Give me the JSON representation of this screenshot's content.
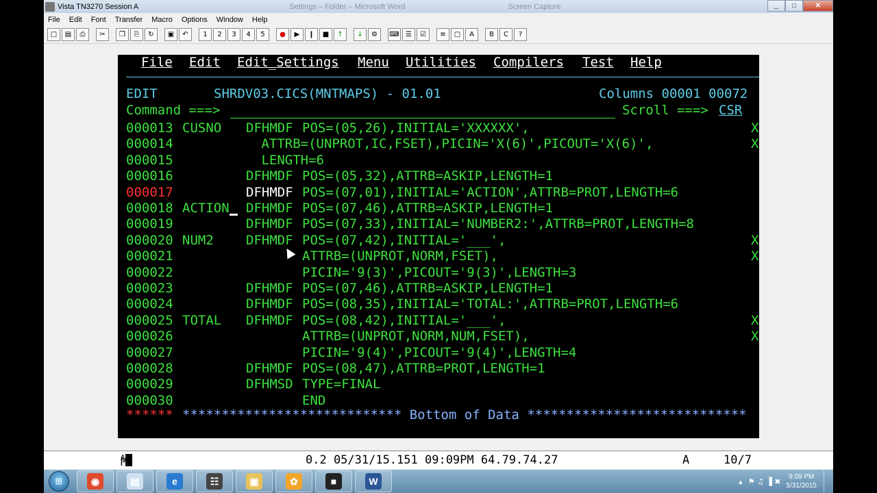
{
  "window": {
    "title": "Vista TN3270 Session A",
    "faded_title_1": "Settings – Folder – Microsoft Word",
    "faded_title_2": "Screen Capture",
    "minimize": "_",
    "maximize": "□",
    "close": "✕"
  },
  "menubar": [
    "File",
    "Edit",
    "Font",
    "Transfer",
    "Macro",
    "Options",
    "Window",
    "Help"
  ],
  "toolbar": {
    "buttons": [
      {
        "icon": "new-doc-icon",
        "glyph": "□"
      },
      {
        "icon": "open-folder-icon",
        "glyph": "▤"
      },
      {
        "icon": "print-icon",
        "glyph": "⎙"
      },
      {
        "icon": "cut-icon",
        "glyph": "✂"
      },
      {
        "icon": "copy-icon",
        "glyph": "❐"
      },
      {
        "icon": "paste-icon",
        "glyph": "⎘"
      },
      {
        "icon": "refresh-icon",
        "glyph": "↻"
      },
      {
        "icon": "window-icon",
        "glyph": "▣"
      },
      {
        "icon": "undo-icon",
        "glyph": "↶"
      },
      {
        "icon": "macro-1-icon",
        "glyph": "1"
      },
      {
        "icon": "macro-2-icon",
        "glyph": "2"
      },
      {
        "icon": "macro-3-icon",
        "glyph": "3"
      },
      {
        "icon": "macro-4-icon",
        "glyph": "4"
      },
      {
        "icon": "macro-5-icon",
        "glyph": "5"
      },
      {
        "icon": "record-icon",
        "glyph": "●"
      },
      {
        "icon": "play-icon",
        "glyph": "▶"
      },
      {
        "icon": "pause-icon",
        "glyph": "❙"
      },
      {
        "icon": "stop-icon",
        "glyph": "■"
      },
      {
        "icon": "upload-icon",
        "glyph": "↑"
      },
      {
        "icon": "download-icon",
        "glyph": "↓"
      },
      {
        "icon": "settings-icon",
        "glyph": "⚙"
      },
      {
        "icon": "keyboard-icon",
        "glyph": "⌨"
      },
      {
        "icon": "ruler-icon",
        "glyph": "☰"
      },
      {
        "icon": "clipboard-icon",
        "glyph": "☑"
      },
      {
        "icon": "list-icon",
        "glyph": "≡"
      },
      {
        "icon": "screen-icon",
        "glyph": "▢"
      },
      {
        "icon": "key-a-icon",
        "glyph": "A"
      },
      {
        "icon": "key-b-icon",
        "glyph": "B"
      },
      {
        "icon": "key-c-icon",
        "glyph": "C"
      },
      {
        "icon": "help-icon",
        "glyph": "?"
      }
    ]
  },
  "terminal": {
    "menu": [
      "File",
      "Edit",
      "Edit_Settings",
      "Menu",
      "Utilities",
      "Compilers",
      "Test",
      "Help"
    ],
    "header_mode": "EDIT",
    "dataset": "SHRDV03.CICS(MNTMAPS) - 01.01",
    "columns": "Columns 00001 00072",
    "command_label": "Command ===>",
    "command_value": "",
    "scroll_label": "Scroll ===>",
    "scroll_value": "CSR",
    "lines": [
      {
        "num": "000013",
        "label": "CUSNO",
        "op": "DFHMDF",
        "text": "POS=(05,26),INITIAL='XXXXXX',",
        "cont": "X",
        "num_color": "g",
        "op_color": "g"
      },
      {
        "num": "000014",
        "label": "",
        "op": "",
        "text": " ATTRB=(UNPROT,IC,FSET),PICIN='X(6)',PICOUT='X(6)',",
        "cont": "X",
        "num_color": "g",
        "op_color": "g"
      },
      {
        "num": "000015",
        "label": "",
        "op": "",
        "text": " LENGTH=6",
        "cont": "",
        "num_color": "g",
        "op_color": "g"
      },
      {
        "num": "000016",
        "label": "",
        "op": "DFHMDF",
        "text": "POS=(05,32),ATTRB=ASKIP,LENGTH=1",
        "cont": "",
        "num_color": "g",
        "op_color": "g"
      },
      {
        "num": "000017",
        "label": "",
        "op": "DFHMDF",
        "text": "POS=(07,01),INITIAL='ACTION',ATTRB=PROT,LENGTH=6",
        "cont": "",
        "num_color": "r",
        "op_color": "w"
      },
      {
        "num": "000018",
        "label": "ACTION",
        "op": "DFHMDF",
        "text": "POS=(07,46),ATTRB=ASKIP,LENGTH=1",
        "cont": "",
        "num_color": "g",
        "op_color": "g"
      },
      {
        "num": "000019",
        "label": "",
        "op": "DFHMDF",
        "text": "POS=(07,33),INITIAL='NUMBER2:',ATTRB=PROT,LENGTH=8",
        "cont": "",
        "num_color": "g",
        "op_color": "g"
      },
      {
        "num": "000020",
        "label": "NUM2",
        "op": "DFHMDF",
        "text": "POS=(07,42),INITIAL='___',",
        "cont": "X",
        "num_color": "g",
        "op_color": "g"
      },
      {
        "num": "000021",
        "label": "",
        "op": "",
        "text": "ATTRB=(UNPROT,NORM,FSET),",
        "cont": "X",
        "num_color": "g",
        "op_color": "g"
      },
      {
        "num": "000022",
        "label": "",
        "op": "",
        "text": "PICIN='9(3)',PICOUT='9(3)',LENGTH=3",
        "cont": "",
        "num_color": "g",
        "op_color": "g"
      },
      {
        "num": "000023",
        "label": "",
        "op": "DFHMDF",
        "text": "POS=(07,46),ATTRB=ASKIP,LENGTH=1",
        "cont": "",
        "num_color": "g",
        "op_color": "g"
      },
      {
        "num": "000024",
        "label": "",
        "op": "DFHMDF",
        "text": "POS=(08,35),INITIAL='TOTAL:',ATTRB=PROT,LENGTH=6",
        "cont": "",
        "num_color": "g",
        "op_color": "g"
      },
      {
        "num": "000025",
        "label": "TOTAL",
        "op": "DFHMDF",
        "text": "POS=(08,42),INITIAL='___',",
        "cont": "X",
        "num_color": "g",
        "op_color": "g"
      },
      {
        "num": "000026",
        "label": "",
        "op": "",
        "text": "ATTRB=(UNPROT,NORM,NUM,FSET),",
        "cont": "X",
        "num_color": "g",
        "op_color": "g"
      },
      {
        "num": "000027",
        "label": "",
        "op": "",
        "text": "PICIN='9(4)',PICOUT='9(4)',LENGTH=4",
        "cont": "",
        "num_color": "g",
        "op_color": "g"
      },
      {
        "num": "000028",
        "label": "",
        "op": "DFHMDF",
        "text": "POS=(08,47),ATTRB=PROT,LENGTH=1",
        "cont": "",
        "num_color": "g",
        "op_color": "g"
      },
      {
        "num": "000029",
        "label": "",
        "op": "DFHMSD",
        "text": "TYPE=FINAL",
        "cont": "",
        "num_color": "g",
        "op_color": "g"
      },
      {
        "num": "000030",
        "label": "",
        "op": "",
        "text": "END",
        "cont": "",
        "num_color": "g",
        "op_color": "g"
      }
    ],
    "bottom_stars_left": "******",
    "bottom_banner": "**************************** Bottom of Data ****************************"
  },
  "status": {
    "mode": "M",
    "mode_sub": "A",
    "info": "0.2 05/31/15.151 09:09PM 64.79.74.27",
    "field": "A",
    "cursor_pos": "10/7"
  },
  "taskbar": {
    "start": "⊞",
    "apps": [
      {
        "icon": "chrome-icon",
        "glyph": "◉",
        "color": "#e04a2f"
      },
      {
        "icon": "notepad-icon",
        "glyph": "▤",
        "color": "#cfe0f0"
      },
      {
        "icon": "internet-explorer-icon",
        "glyph": "e",
        "color": "#2a7bd1"
      },
      {
        "icon": "network-icon",
        "glyph": "☷",
        "color": "#444"
      },
      {
        "icon": "explorer-folder-icon",
        "glyph": "▣",
        "color": "#e7c35a"
      },
      {
        "icon": "flower-app-icon",
        "glyph": "✿",
        "color": "#f3a62a"
      },
      {
        "icon": "terminal-app-icon",
        "glyph": "■",
        "color": "#222"
      },
      {
        "icon": "word-icon",
        "glyph": "W",
        "color": "#2b5797"
      }
    ],
    "tray": {
      "arrow": "▴",
      "icons": "⚑ ♫ ▐ ✖",
      "time": "9:09 PM",
      "date": "5/31/2015"
    }
  }
}
